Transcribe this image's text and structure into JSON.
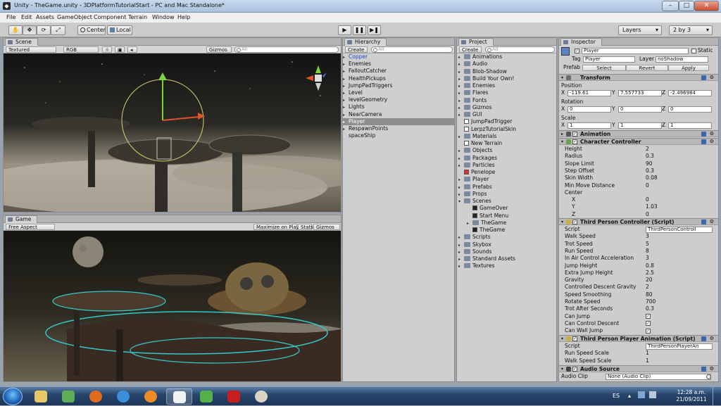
{
  "window": {
    "title": "Unity - TheGame.unity - 3DPlatformTutorialStart - PC and Mac Standalone*",
    "min": "–",
    "max": "□",
    "close": "✕"
  },
  "menu": [
    "File",
    "Edit",
    "Assets",
    "GameObject",
    "Component",
    "Terrain",
    "Window",
    "Help"
  ],
  "toolbar": {
    "tools": [
      "hand-icon",
      "move-icon",
      "rotate-icon",
      "scale-icon"
    ],
    "pivot": "Center",
    "space": "Local",
    "play": "▶",
    "pause": "❚❚",
    "step": "▶❚",
    "layers": "Layers",
    "layout": "2 by 3"
  },
  "scene": {
    "tab": "Scene",
    "shading": "Textured",
    "mode": "RGB",
    "gizmos": "Gizmos",
    "search": "All"
  },
  "game": {
    "tab": "Game",
    "aspect": "Free Aspect",
    "maximize": "Maximize on Play",
    "stats": "Stats",
    "gizmos": "Gizmos"
  },
  "hierarchy": {
    "tab": "Hierarchy",
    "create": "Create",
    "search": "All",
    "items": [
      "Copper",
      "Enemies",
      "FalloutCatcher",
      "HealthPickups",
      "JumpPadTriggers",
      "Level",
      "levelGeometry",
      "Lights",
      "NearCamera",
      "Player",
      "RespawnPoints",
      "spaceShip"
    ]
  },
  "project": {
    "tab": "Project",
    "create": "Create",
    "search": "All",
    "items": [
      {
        "label": "Animations",
        "type": "folder",
        "indent": 0
      },
      {
        "label": "Audio",
        "type": "folder",
        "indent": 0
      },
      {
        "label": "Blob-Shadow",
        "type": "folder",
        "indent": 0
      },
      {
        "label": "Build Your Own!",
        "type": "folder",
        "indent": 0
      },
      {
        "label": "Enemies",
        "type": "folder",
        "indent": 0
      },
      {
        "label": "Flares",
        "type": "folder",
        "indent": 0
      },
      {
        "label": "Fonts",
        "type": "folder",
        "indent": 0
      },
      {
        "label": "Gizmos",
        "type": "folder",
        "indent": 0
      },
      {
        "label": "GUI",
        "type": "folder",
        "indent": 0
      },
      {
        "label": "JumpPadTrigger",
        "type": "asset",
        "indent": 0
      },
      {
        "label": "LerpzTutorialSkin",
        "type": "asset",
        "indent": 0
      },
      {
        "label": "Materials",
        "type": "folder",
        "indent": 0
      },
      {
        "label": "New Terrain",
        "type": "asset",
        "indent": 0
      },
      {
        "label": "Objects",
        "type": "folder",
        "indent": 0
      },
      {
        "label": "Packages",
        "type": "folder",
        "indent": 0
      },
      {
        "label": "Particles",
        "type": "folder",
        "indent": 0
      },
      {
        "label": "Penelope",
        "type": "pdf",
        "indent": 0
      },
      {
        "label": "Player",
        "type": "folder",
        "indent": 0
      },
      {
        "label": "Prefabs",
        "type": "folder",
        "indent": 0
      },
      {
        "label": "Props",
        "type": "folder",
        "indent": 0
      },
      {
        "label": "Scenes",
        "type": "folder-open",
        "indent": 0
      },
      {
        "label": "GameOver",
        "type": "scene",
        "indent": 1
      },
      {
        "label": "Start Menu",
        "type": "scene",
        "indent": 1
      },
      {
        "label": "TheGame",
        "type": "folder",
        "indent": 1
      },
      {
        "label": "TheGame",
        "type": "scene",
        "indent": 1
      },
      {
        "label": "Scripts",
        "type": "folder",
        "indent": 0
      },
      {
        "label": "Skybox",
        "type": "folder",
        "indent": 0
      },
      {
        "label": "Sounds",
        "type": "folder",
        "indent": 0
      },
      {
        "label": "Standard Assets",
        "type": "folder",
        "indent": 0
      },
      {
        "label": "Textures",
        "type": "folder",
        "indent": 0
      }
    ]
  },
  "inspector": {
    "tab": "Inspector",
    "object_name": "Player",
    "static": "Static",
    "tag_label": "Tag",
    "tag": "Player",
    "layer_label": "Layer",
    "layer": "noShadow",
    "prefab_label": "Prefab",
    "select": "Select",
    "revert": "Revert",
    "apply": "Apply",
    "transform": {
      "title": "Transform",
      "position": "Position",
      "rotation": "Rotation",
      "scale": "Scale",
      "x": "X",
      "y": "Y",
      "z": "Z",
      "pos": [
        "-119.61",
        "7.557733",
        "-2.496984"
      ],
      "rot": [
        "0",
        "0",
        "0"
      ],
      "scl": [
        "1",
        "1",
        "1"
      ]
    },
    "animation": {
      "title": "Animation"
    },
    "character_controller": {
      "title": "Character Controller",
      "props": [
        [
          "Height",
          "2"
        ],
        [
          "Radius",
          "0.3"
        ],
        [
          "Slope Limit",
          "90"
        ],
        [
          "Step Offset",
          "0.3"
        ],
        [
          "Skin Width",
          "0.08"
        ],
        [
          "Min Move Distance",
          "0"
        ]
      ],
      "center": "Center",
      "center_vals": [
        [
          "X",
          "0"
        ],
        [
          "Y",
          "1.03"
        ],
        [
          "Z",
          "0"
        ]
      ]
    },
    "tpc": {
      "title": "Third Person Controller (Script)",
      "script_label": "Script",
      "script": "ThirdPersonControll",
      "props": [
        [
          "Walk Speed",
          "3"
        ],
        [
          "Trot Speed",
          "5"
        ],
        [
          "Run Speed",
          "8"
        ],
        [
          "In Air Control Acceleration",
          "3"
        ],
        [
          "Jump Height",
          "0.8"
        ],
        [
          "Extra Jump Height",
          "2.5"
        ],
        [
          "Gravity",
          "20"
        ],
        [
          "Controlled Descent Gravity",
          "2"
        ],
        [
          "Speed Smoothing",
          "80"
        ],
        [
          "Rotate Speed",
          "700"
        ],
        [
          "Trot After Seconds",
          "0.3"
        ]
      ],
      "checks": [
        "Can Jump",
        "Can Control Descent",
        "Can Wall Jump"
      ],
      "check_mark": "✓"
    },
    "tpa": {
      "title": "Third Person Player Animation (Script)",
      "script_label": "Script",
      "script": "ThirdPersonPlayerAn",
      "props": [
        [
          "Run Speed Scale",
          "1"
        ],
        [
          "Walk Speed Scale",
          "1"
        ]
      ]
    },
    "audio": {
      "title": "Audio Source",
      "clip_label": "Audio Clip",
      "clip": "None (Audio Clip)"
    }
  },
  "taskbar": {
    "lang": "ES",
    "time": "12:28 a.m.",
    "date": "21/09/2011",
    "apps": [
      "start-orb-icon",
      "explorer-icon",
      "msn-icon",
      "firefox-icon",
      "ie-icon",
      "blender-icon",
      "unity-icon",
      "messenger-icon",
      "acrobat-icon",
      "paint-icon"
    ]
  }
}
